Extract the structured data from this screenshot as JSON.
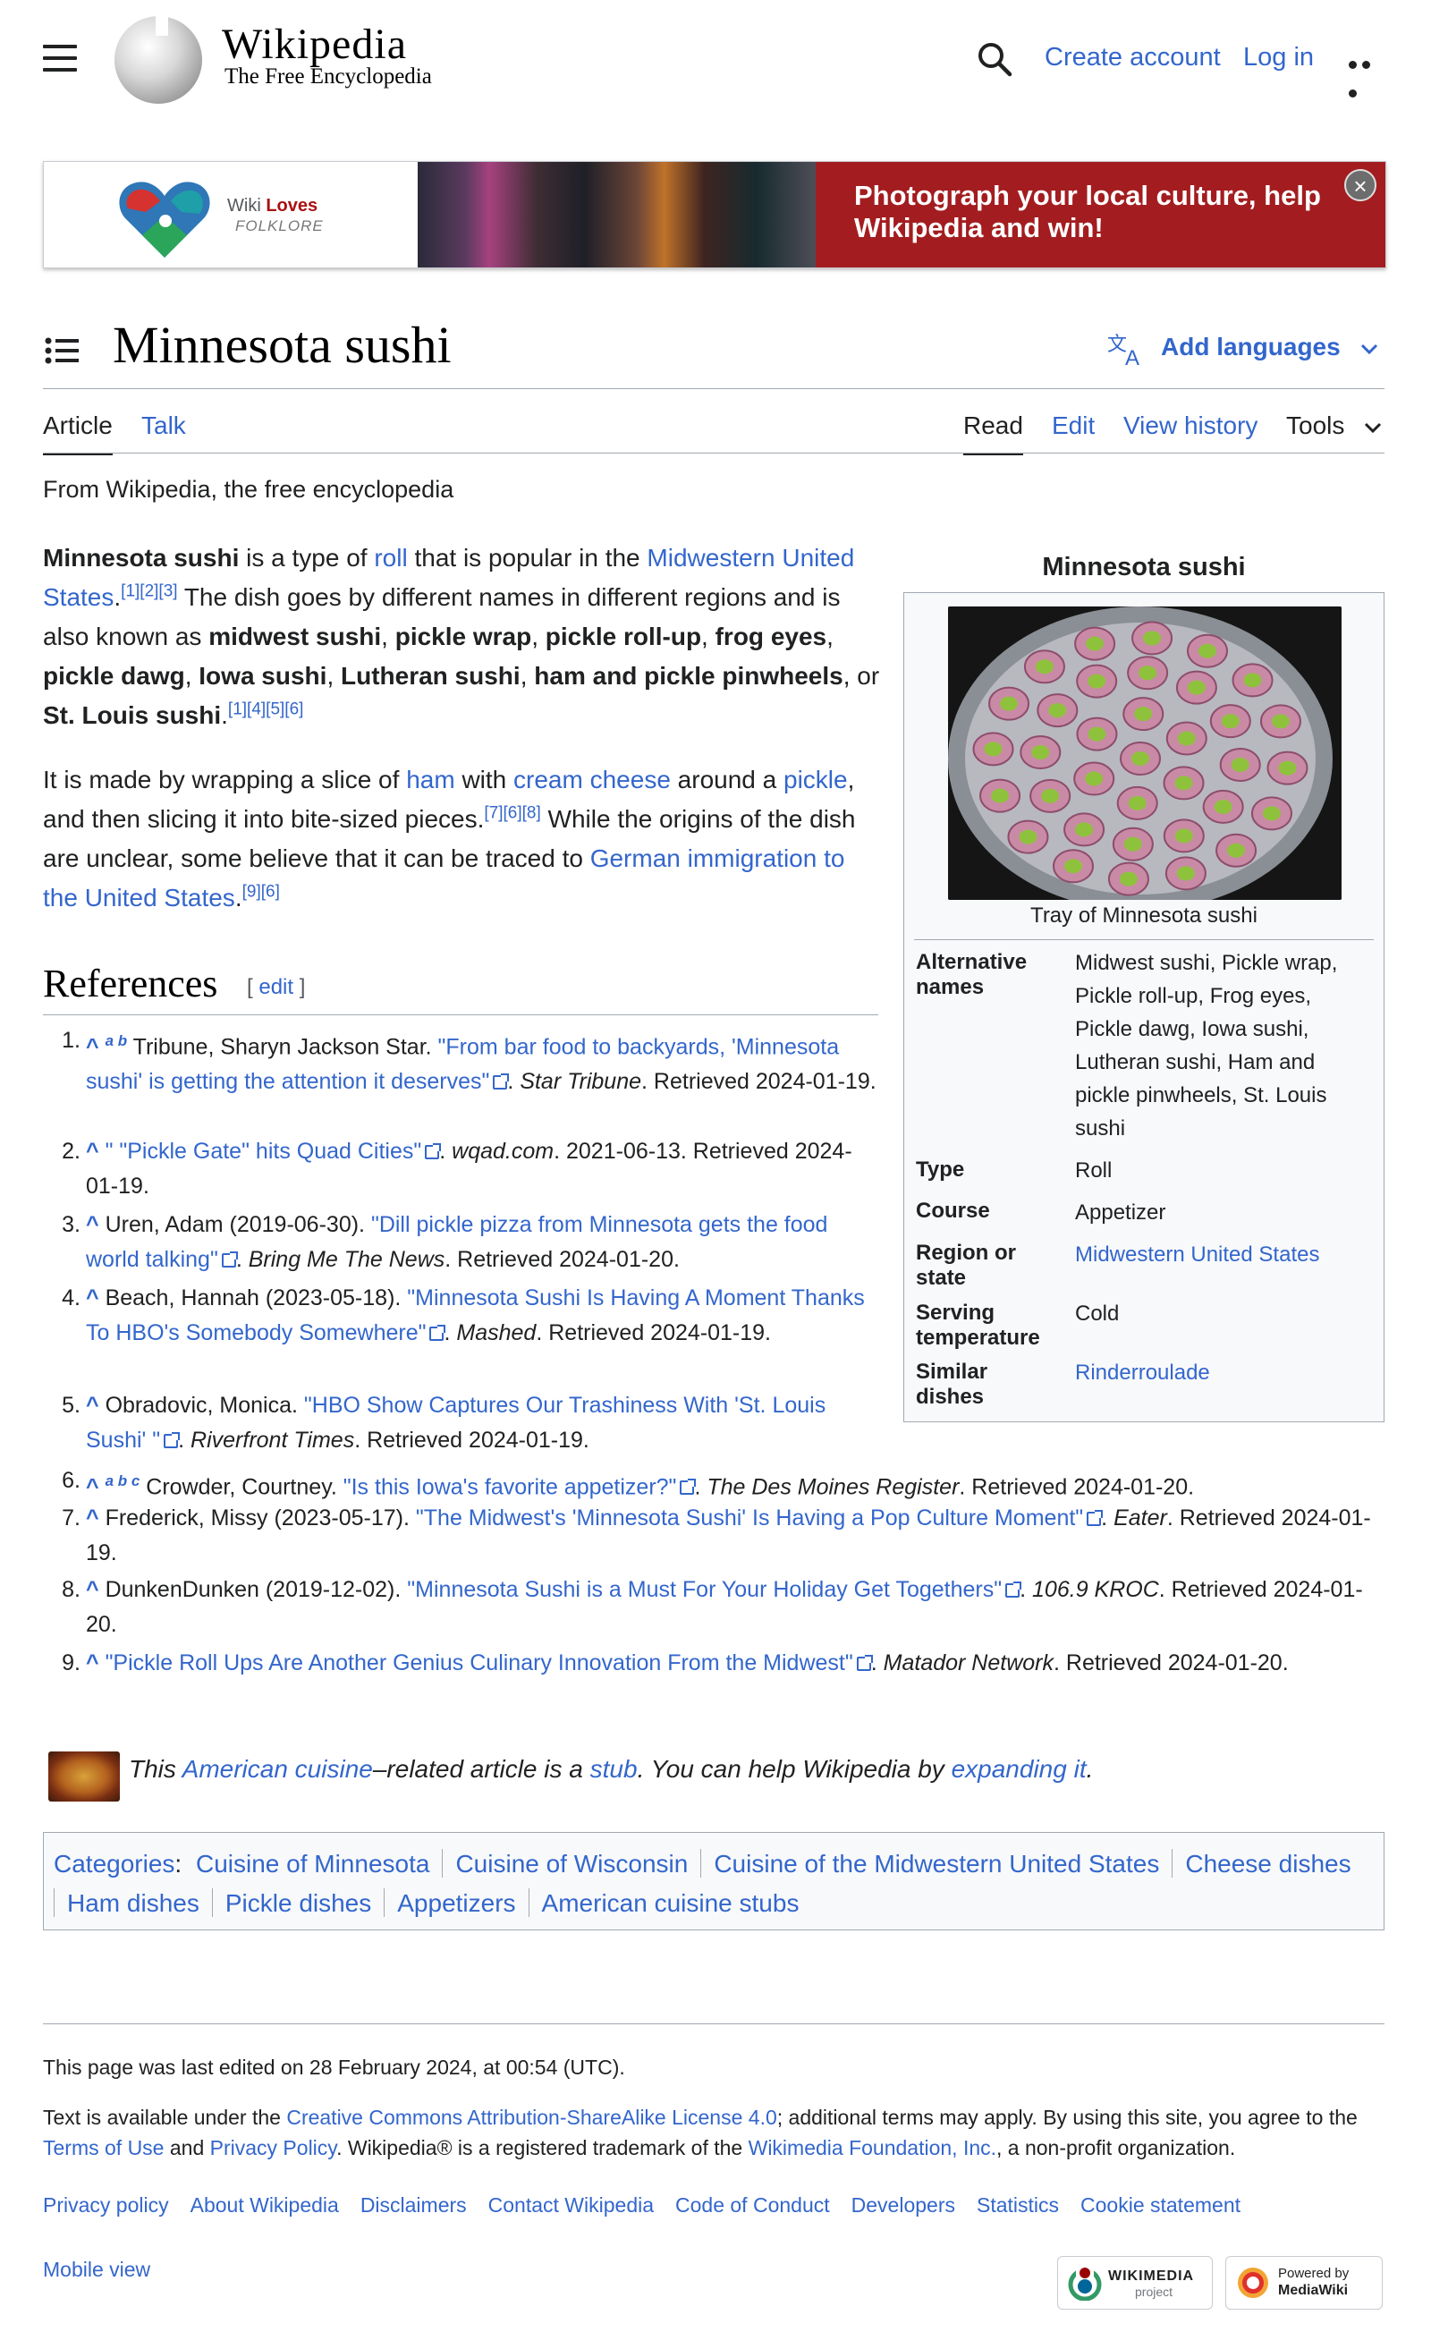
{
  "header": {
    "site_title": "Wikipedia",
    "tagline": "The Free Encyclopedia",
    "create_account": "Create account",
    "log_in": "Log in"
  },
  "banner": {
    "logo_wiki": "Wiki",
    "logo_loves": "Loves",
    "logo_folklore": "FOLKLORE",
    "text": "Photograph your local culture, help Wikipedia and win!",
    "close_symbol": "×"
  },
  "page": {
    "title": "Minnesota sushi",
    "add_languages": "Add languages",
    "tabs_left": [
      "Article",
      "Talk"
    ],
    "tabs_right": [
      "Read",
      "Edit",
      "View history",
      "Tools"
    ],
    "from": "From Wikipedia, the free encyclopedia"
  },
  "intro": {
    "p1": {
      "lead_bold": "Minnesota sushi",
      "t1": " is a type of ",
      "roll_link": "roll",
      "t2": " that is popular in the ",
      "midwest_link": "Midwestern United States",
      "t3": ".",
      "cite1": "[1][2][3]",
      "t4": " The dish goes by different names in different regions and is also known as ",
      "n1": "midwest sushi",
      "c1": ", ",
      "n2": "pickle wrap",
      "c2": ", ",
      "n3": "pickle roll-up",
      "c3": ", ",
      "n4": "frog eyes",
      "c4": ", ",
      "n5": "pickle dawg",
      "c5": ", ",
      "n6": "Iowa sushi",
      "c6": ", ",
      "n7": "Lutheran sushi",
      "c7": ", ",
      "n8": "ham and pickle pinwheels",
      "c8": ", or ",
      "n9": "St. Louis sushi",
      "t5": ".",
      "cite2": "[1][4][5][6]"
    },
    "p2": {
      "t1": "It is made by wrapping a slice of ",
      "ham_link": "ham",
      "t2": " with ",
      "cream_link": "cream cheese",
      "t3": " around a ",
      "pickle_link": "pickle",
      "t4": ", and then slicing it into bite-sized pieces.",
      "cite1": "[7][6][8]",
      "t5": " While the origins of the dish are unclear, some believe that it can be traced to ",
      "german_link": "German immigration to the United States",
      "t6": ".",
      "cite2": "[9][6]"
    }
  },
  "infobox": {
    "title": "Minnesota sushi",
    "caption": "Tray of Minnesota sushi",
    "rows": [
      {
        "label": "Alternative names",
        "value": "Midwest sushi, Pickle wrap, Pickle roll-up, Frog eyes, Pickle dawg, Iowa sushi, Lutheran sushi, Ham and pickle pinwheels, St. Louis sushi"
      },
      {
        "label": "Type",
        "value": "Roll"
      },
      {
        "label": "Course",
        "value": "Appetizer"
      },
      {
        "label": "Region or state",
        "value": "Midwestern United States"
      },
      {
        "label": "Serving temperature",
        "value": "Cold"
      },
      {
        "label": "Similar dishes",
        "value": "Rinderroulade"
      }
    ]
  },
  "references": {
    "heading": "References",
    "edit_open": "[ ",
    "edit": "edit",
    "edit_close": " ]",
    "items": [
      {
        "num": "1.",
        "back": "^",
        "letters": "a b",
        "pre": "Tribune, Sharyn Jackson Star. ",
        "title": "\"From bar food to backyards, 'Minnesota sushi' is getting the attention it deserves\"",
        "mid": ". ",
        "pub": "Star Tribune",
        "post": ". Retrieved 2024-01-19."
      },
      {
        "num": "2.",
        "back": "^",
        "letters": "",
        "pre": "",
        "title": "\" \"Pickle Gate\" hits Quad Cities\"",
        "mid": ". ",
        "pub": "wqad.com",
        "post": ". 2021-06-13. Retrieved 2024-01-19."
      },
      {
        "num": "3.",
        "back": "^",
        "letters": "",
        "pre": "Uren, Adam (2019-06-30). ",
        "title": "\"Dill pickle pizza from Minnesota gets the food world talking\"",
        "mid": ". ",
        "pub": "Bring Me The News",
        "post": ". Retrieved 2024-01-20."
      },
      {
        "num": "4.",
        "back": "^",
        "letters": "",
        "pre": "Beach, Hannah (2023-05-18). ",
        "title": "\"Minnesota Sushi Is Having A Moment Thanks To HBO's Somebody Somewhere\"",
        "mid": ". ",
        "pub": "Mashed",
        "post": ". Retrieved 2024-01-19."
      },
      {
        "num": "5.",
        "back": "^",
        "letters": "",
        "pre": "Obradovic, Monica. ",
        "title": "\"HBO Show Captures Our Trashiness With 'St. Louis Sushi' \"",
        "mid": ". ",
        "pub": "Riverfront Times",
        "post": ". Retrieved 2024-01-19."
      },
      {
        "num": "6.",
        "back": "^",
        "letters": "a b c",
        "pre": "Crowder, Courtney. ",
        "title": "\"Is this Iowa's favorite appetizer?\"",
        "mid": ". ",
        "pub": "The Des Moines Register",
        "post": ". Retrieved 2024-01-20."
      },
      {
        "num": "7.",
        "back": "^",
        "letters": "",
        "pre": "Frederick, Missy (2023-05-17). ",
        "title": "\"The Midwest's 'Minnesota Sushi' Is Having a Pop Culture Moment\"",
        "mid": ". ",
        "pub": "Eater",
        "post": ". Retrieved 2024-01-19."
      },
      {
        "num": "8.",
        "back": "^",
        "letters": "",
        "pre": "DunkenDunken (2019-12-02). ",
        "title": "\"Minnesota Sushi is a Must For Your Holiday Get Togethers\"",
        "mid": ". ",
        "pub": "106.9 KROC",
        "post": ". Retrieved 2024-01-20."
      },
      {
        "num": "9.",
        "back": "^",
        "letters": "",
        "pre": "",
        "title": "\"Pickle Roll Ups Are Another Genius Culinary Innovation From the Midwest\"",
        "mid": ". ",
        "pub": "Matador Network",
        "post": ". Retrieved 2024-01-20."
      }
    ]
  },
  "stub": {
    "t1": "This ",
    "link1": "American cuisine",
    "t2": "–related article is a ",
    "link2": "stub",
    "t3": ". You can help Wikipedia by ",
    "link3": "expanding it",
    "t4": "."
  },
  "categories": {
    "label": "Categories",
    "colon": ":",
    "items": [
      "Cuisine of Minnesota",
      "Cuisine of Wisconsin",
      "Cuisine of the Midwestern United States",
      "Cheese dishes",
      "Ham dishes",
      "Pickle dishes",
      "Appetizers",
      "American cuisine stubs"
    ]
  },
  "footer": {
    "last_edited": "This page was last edited on 28 February 2024, at 00:54 (UTC).",
    "lic_1": "Text is available under the ",
    "lic_link": "Creative Commons Attribution-ShareAlike License 4.0",
    "lic_2": "; additional terms may apply. By using this site, you agree to the ",
    "terms": "Terms of Use",
    "and": " and ",
    "privacy": "Privacy Policy",
    "lic_3": ". Wikipedia® is a registered trademark of the ",
    "foundation": "Wikimedia Foundation, Inc.",
    "lic_4": ", a non-profit organization.",
    "links": [
      "Privacy policy",
      "About Wikipedia",
      "Disclaimers",
      "Contact Wikipedia",
      "Code of Conduct",
      "Developers",
      "Statistics",
      "Cookie statement"
    ],
    "mobile_view": "Mobile view",
    "wikimedia_badge_1": "WIKIMEDIA",
    "wikimedia_badge_2": "project",
    "mediawiki_badge_1": "Powered by",
    "mediawiki_badge_2": "MediaWiki"
  },
  "colors": {
    "link": "#3366cc",
    "banner_red": "#a31d20",
    "text": "#202122",
    "border": "#a2a9b1"
  },
  "icons": [
    "menu-icon",
    "wikipedia-globe-logo",
    "search-icon",
    "more-icon",
    "close-icon",
    "toc-icon",
    "translate-icon",
    "chevron-down-icon",
    "external-link-icon"
  ]
}
